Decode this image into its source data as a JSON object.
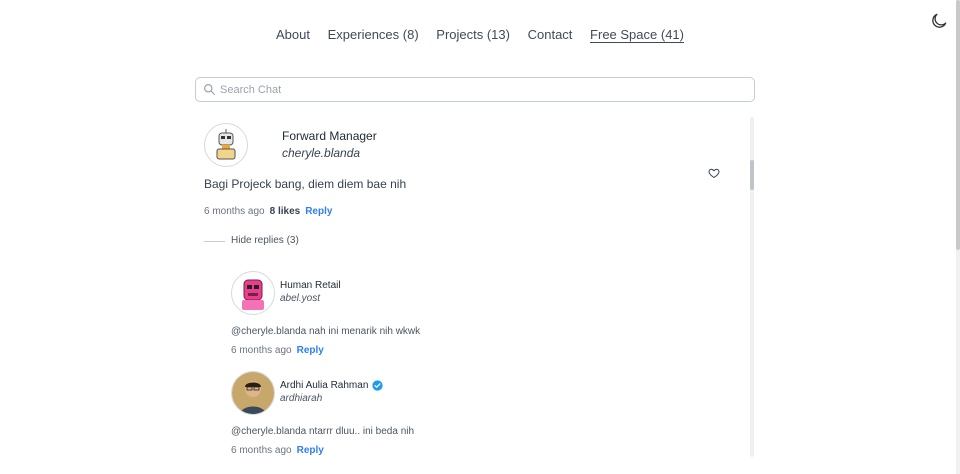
{
  "nav": {
    "items": [
      {
        "label": "About"
      },
      {
        "label": "Experiences (8)"
      },
      {
        "label": "Projects (13)"
      },
      {
        "label": "Contact"
      },
      {
        "label": "Free Space (41)"
      }
    ],
    "active_index": 4
  },
  "theme_toggle_icon": "moon-icon",
  "search": {
    "placeholder": "Search Chat",
    "value": "",
    "icon": "search-icon"
  },
  "comment": {
    "name": "Forward Manager",
    "username": "cheryle.blanda",
    "text": "Bagi Projeck bang, diem diem bae nih",
    "time": "6 months ago",
    "likes": "8 likes",
    "reply_label": "Reply",
    "like_icon": "heart-icon",
    "hide_replies_label": "Hide replies (3)",
    "replies": [
      {
        "name": "Human Retail",
        "username": "abel.yost",
        "text": "@cheryle.blanda nah ini menarik nih wkwk",
        "time": "6 months ago",
        "reply_label": "Reply"
      },
      {
        "name": "Ardhi Aulia Rahman",
        "username": "ardhiarah",
        "verified": true,
        "text": "@cheryle.blanda ntarrr dluu.. ini beda nih",
        "time": "6 months ago",
        "reply_label": "Reply"
      }
    ]
  },
  "colors": {
    "link": "#2f80ed",
    "verified": "#1d9bf0"
  }
}
